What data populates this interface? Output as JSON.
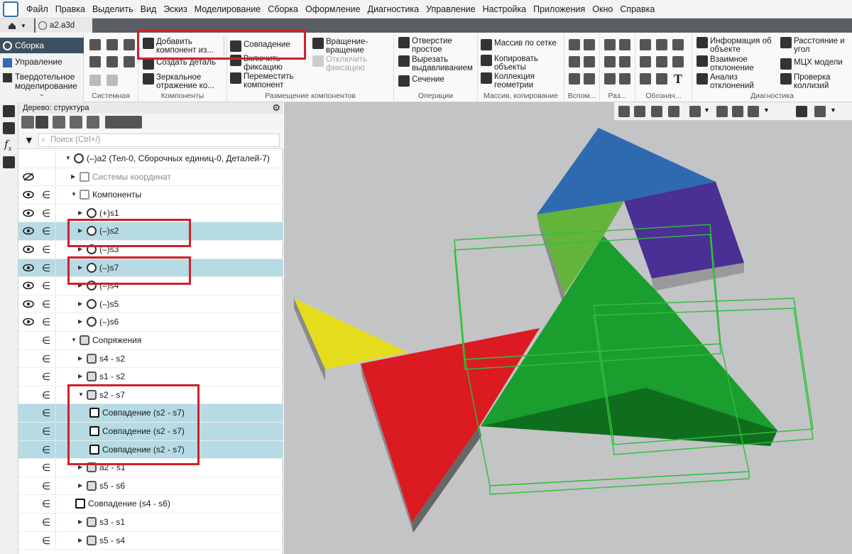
{
  "menu": [
    "Файл",
    "Правка",
    "Выделить",
    "Вид",
    "Эскиз",
    "Моделирование",
    "Сборка",
    "Оформление",
    "Диагностика",
    "Управление",
    "Настройка",
    "Приложения",
    "Окно",
    "Справка"
  ],
  "document_tab": "a2.a3d",
  "ribbon_left": {
    "sborka": "Сборка",
    "upravlenie": "Управление",
    "tverdotel": "Твердотельное моделирование"
  },
  "ribbon": {
    "system_label": "Системная",
    "components": {
      "add": "Добавить компонент из...",
      "create": "Создать деталь",
      "mirror": "Зеркальное отражение ко...",
      "label": "Компоненты"
    },
    "placement": {
      "coincidence": "Совпадение",
      "rotate": "Вращение-вращение",
      "enable_fix": "Включить фиксацию",
      "disable_fix": "Отключить фиксацию",
      "move": "Переместить компонент",
      "label": "Размещение компонентов"
    },
    "operations": {
      "hole": "Отверстие простое",
      "cut_extrude": "Вырезать выдавливанием",
      "section": "Сечение",
      "label": "Операции"
    },
    "array": {
      "grid": "Массив по сетке",
      "copy": "Копировать объекты",
      "collection": "Коллекция геометрии",
      "label": "Массив, копирование"
    },
    "aux_label": "Вспом...",
    "size_label": "Раз...",
    "designation_label": "Обознач...",
    "diagnostics": {
      "info": "Информация об объекте",
      "mutual": "Взаимное отклонение",
      "analysis": "Анализ отклонений",
      "distance": "Расстояние и угол",
      "mcx": "МЦХ модели",
      "collision": "Проверка коллизий",
      "label": "Диагностика"
    }
  },
  "tree": {
    "header": "Дерево: структура",
    "search_placeholder": "Поиск (Ctrl+/)",
    "rows": [
      {
        "label": "(–)a2 (Тел-0, Сборочных единиц-0, Деталей-7)",
        "indent": 0
      },
      {
        "label": "Системы координат",
        "indent": 1,
        "gray": true
      },
      {
        "label": "Компоненты",
        "indent": 1
      },
      {
        "label": "(+)s1",
        "indent": 2
      },
      {
        "label": "(–)s2",
        "indent": 2,
        "selected": true
      },
      {
        "label": "(–)s3",
        "indent": 2
      },
      {
        "label": "(–)s7",
        "indent": 2,
        "selected": true
      },
      {
        "label": "(–)s4",
        "indent": 2
      },
      {
        "label": "(–)s5",
        "indent": 2
      },
      {
        "label": "(–)s6",
        "indent": 2
      },
      {
        "label": "Сопряжения",
        "indent": 1
      },
      {
        "label": "s4 - s2",
        "indent": 2
      },
      {
        "label": "s1 - s2",
        "indent": 2
      },
      {
        "label": "s2 - s7",
        "indent": 2
      },
      {
        "label": "Совпадение (s2 - s7)",
        "indent": 3,
        "selected": true
      },
      {
        "label": "Совпадение (s2 - s7)",
        "indent": 3,
        "selected": true
      },
      {
        "label": "Совпадение (s2 - s7)",
        "indent": 3,
        "selected": true
      },
      {
        "label": "a2 - s1",
        "indent": 2
      },
      {
        "label": "s5 - s6",
        "indent": 2
      },
      {
        "label": "Совпадение (s4 - s6)",
        "indent": 2
      },
      {
        "label": "s3 - s1",
        "indent": 2
      },
      {
        "label": "s5 - s4",
        "indent": 2
      }
    ]
  },
  "colors": {
    "accent": "#2f6fb2",
    "selection": "#b7dbe5",
    "highlight": "#d0202a",
    "blue_piece": "#2e6ab0",
    "purple_piece": "#4a2f94",
    "green_piece": "#1a9e2e",
    "lightgreen_piece": "#64b43c",
    "yellow_piece": "#e6dc1e",
    "red_piece": "#dc1a22"
  }
}
